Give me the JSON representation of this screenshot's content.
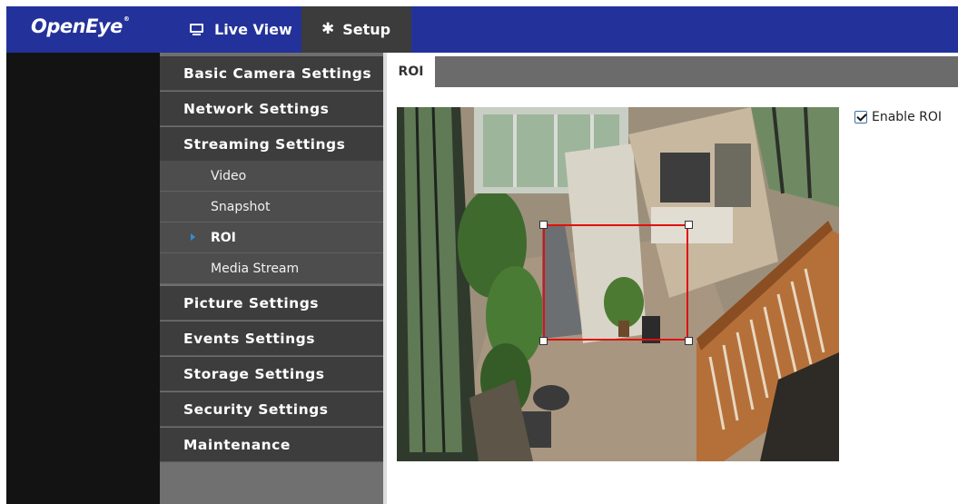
{
  "app": {
    "logo_text": "OpenEye",
    "logo_mark": "®"
  },
  "topnav": {
    "live_view_label": "Live View",
    "setup_label": "Setup",
    "live_view_icon": "monitor-icon",
    "setup_icon": "gear-icon"
  },
  "sidebar": {
    "items": [
      {
        "label": "Basic Camera Settings"
      },
      {
        "label": "Network Settings"
      },
      {
        "label": "Streaming Settings"
      },
      {
        "label": "Picture Settings"
      },
      {
        "label": "Events Settings"
      },
      {
        "label": "Storage Settings"
      },
      {
        "label": "Security Settings"
      },
      {
        "label": "Maintenance"
      }
    ],
    "streaming_subitems": [
      {
        "label": "Video"
      },
      {
        "label": "Snapshot"
      },
      {
        "label": "ROI",
        "active": true
      },
      {
        "label": "Media Stream"
      }
    ]
  },
  "content": {
    "tab_label": "ROI",
    "enable_roi_label": "Enable ROI",
    "enable_roi_checked": true
  },
  "colors": {
    "topbar": "#23329a",
    "setup_tab": "#3c3c3c",
    "sidebar_item": "#3d3d3d",
    "sidebar_sub": "#4d4d4d",
    "roi_box": "#e01010",
    "active_arrow": "#2f8fd8"
  }
}
